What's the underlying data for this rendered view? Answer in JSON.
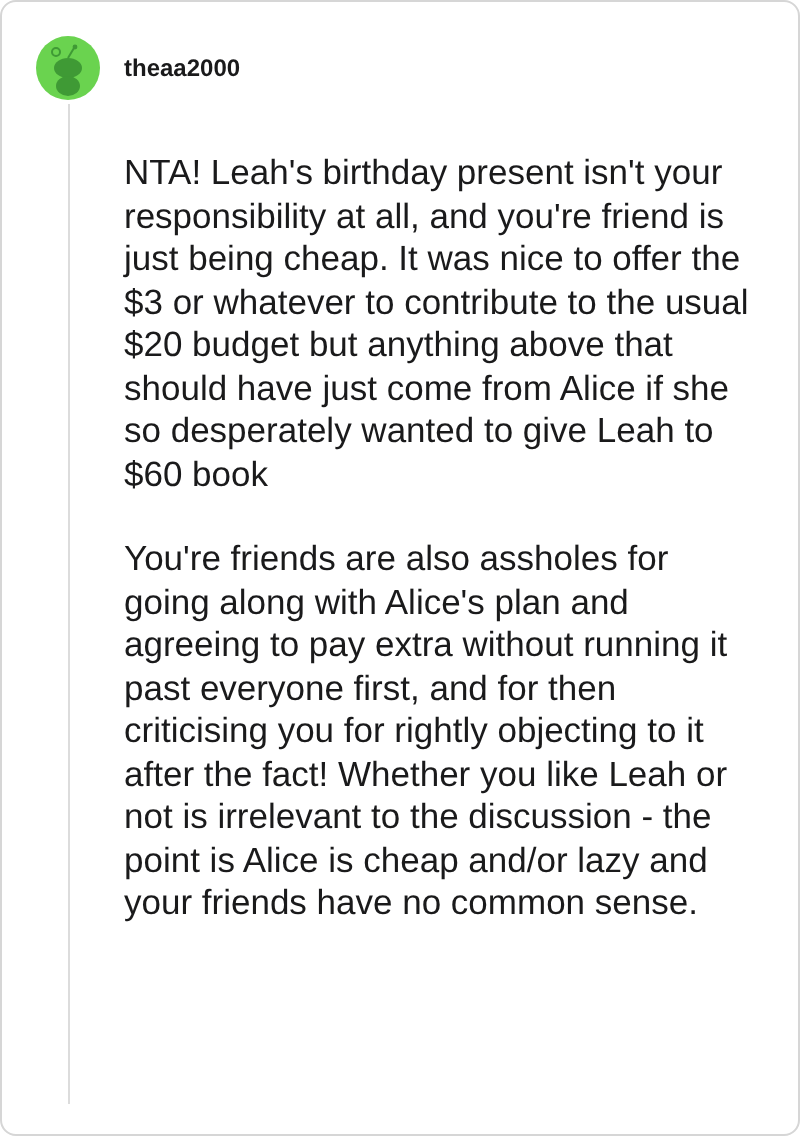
{
  "comment": {
    "username": "theaa2000",
    "paragraphs": [
      "NTA! Leah's birthday present isn't your responsibility at all, and you're friend is just being cheap. It was nice to offer the $3 or whatever to contribute to the usual $20 budget but anything above that should have just come from Alice if she so desperately wanted to give Leah to $60 book",
      "You're friends are also assholes for going along with Alice's plan and agreeing to pay extra without running it past everyone first, and for then criticising you for rightly objecting to it after the fact! Whether you like Leah or not is irrelevant to the discussion - the point is Alice is cheap and/or lazy and your friends have no common sense."
    ]
  }
}
